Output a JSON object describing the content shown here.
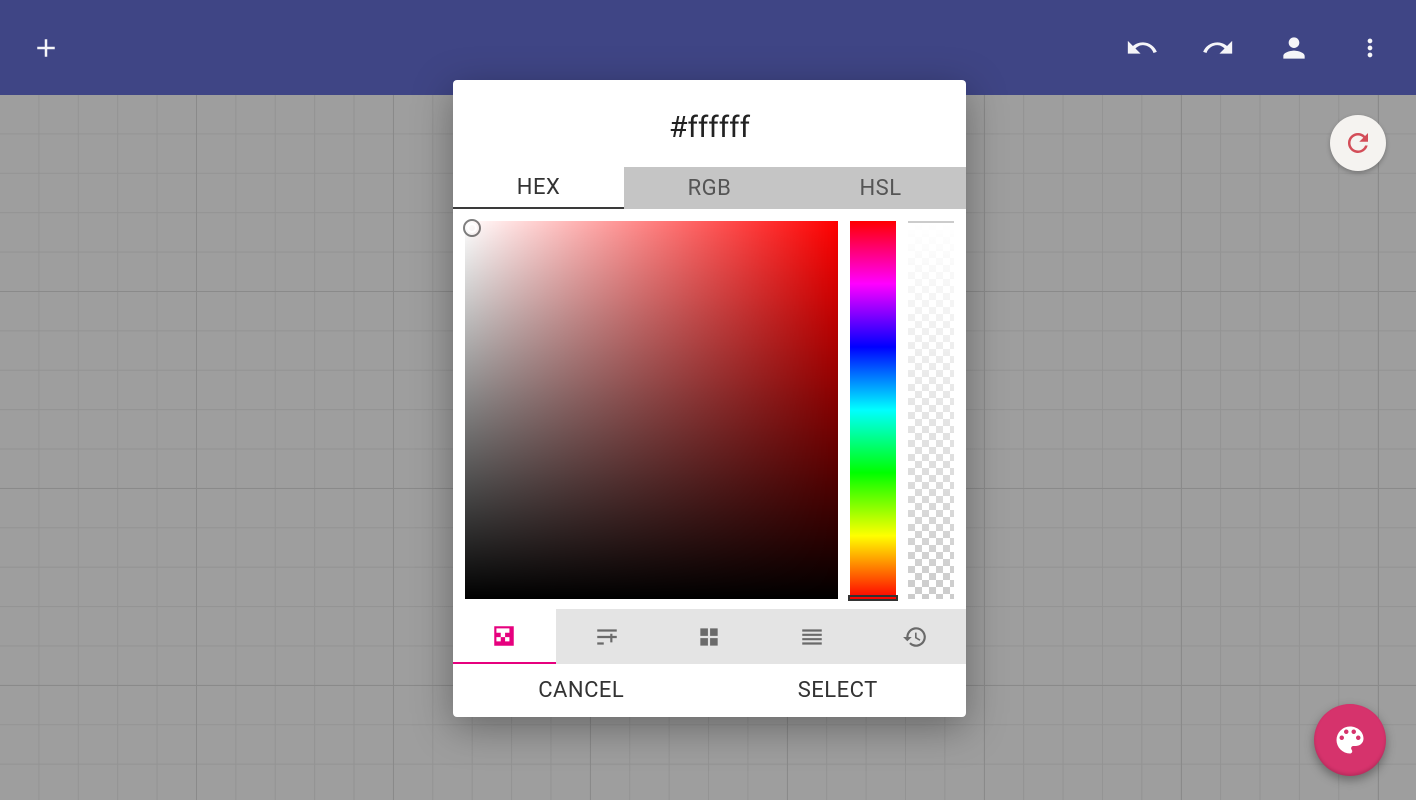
{
  "appbar": {
    "add": "add",
    "undo": "undo",
    "redo": "redo",
    "profile": "profile",
    "more": "more"
  },
  "canvas": {
    "refresh": "refresh",
    "palette_fab": "palette"
  },
  "dialog": {
    "title": "#ffffff",
    "tabs": {
      "hex": "HEX",
      "rgb": "RGB",
      "hsl": "HSL",
      "active": "HEX"
    },
    "toolstrip": {
      "transparency": "transparency",
      "sliders": "sliders",
      "swatches": "swatches",
      "list": "list",
      "history": "history",
      "active": "transparency"
    },
    "actions": {
      "cancel": "CANCEL",
      "select": "SELECT"
    },
    "current_color_hex": "#ffffff",
    "hue_deg": 0,
    "alpha": 1.0
  }
}
